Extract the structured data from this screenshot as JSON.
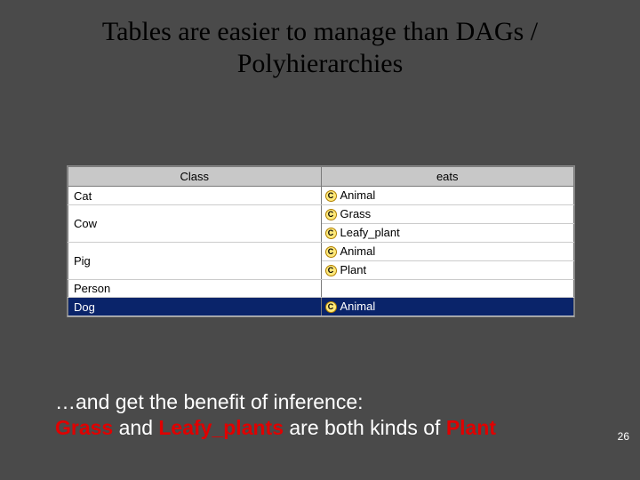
{
  "title_line1": "Tables are easier to manage than DAGs /",
  "title_line2": "Polyhierarchies",
  "columns": {
    "class": "Class",
    "eats": "eats"
  },
  "rows": [
    {
      "class": "Cat",
      "eats": [
        "Animal"
      ],
      "selected": false
    },
    {
      "class": "Cow",
      "eats": [
        "Grass",
        "Leafy_plant"
      ],
      "selected": false
    },
    {
      "class": "Pig",
      "eats": [
        "Animal",
        "Plant"
      ],
      "selected": false
    },
    {
      "class": "Person",
      "eats": [],
      "selected": false
    },
    {
      "class": "Dog",
      "eats": [
        "Animal"
      ],
      "selected": true
    }
  ],
  "icon_glyph": "C",
  "footer": {
    "lead": "…and get the benefit of inference:",
    "grass": "Grass",
    "and": " and ",
    "leafy": "Leafy_plants",
    "mid": " are both kinds of ",
    "plant": "Plant"
  },
  "page_number": "26"
}
